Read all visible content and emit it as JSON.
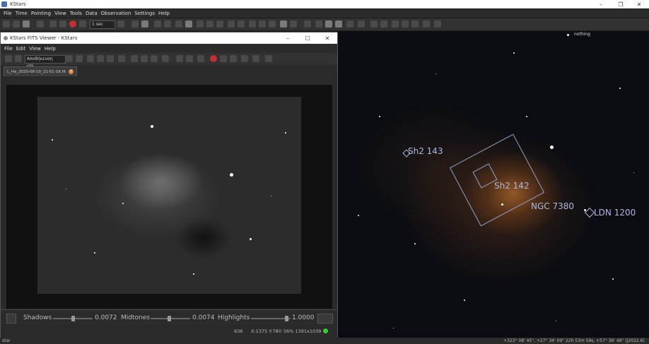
{
  "main_window": {
    "title": "KStars",
    "menu": [
      "File",
      "Time",
      "Pointing",
      "View",
      "Tools",
      "Data",
      "Observation",
      "Settings",
      "Help"
    ],
    "timestep": "1 sec",
    "status_left": "star",
    "status_right": "+323° 08' 45\", +27° 34' 09\" 22h 53m 59s, +57° 36' 48\" (J2022.6)"
  },
  "sky_map": {
    "labels": {
      "nothing": "nothing",
      "sh2_143": "Sh2 143",
      "sh2_142": "Sh2 142",
      "ngc_7380": "NGC 7380",
      "ldn_1200": "LDN 1200"
    }
  },
  "fits_viewer": {
    "title": "KStars FITS Viewer - KStars",
    "menu": [
      "File",
      "Edit",
      "View",
      "Help"
    ],
    "filter_dropdown": "Αποθήκευση ισχ...",
    "tab_label": "L_Ha_2020-08-19_21-51-18.fit",
    "stretch": {
      "shadows_label": "Shadows",
      "shadows_value": "0.0072",
      "midtones_label": "Midtones",
      "midtones_value": "0.0074",
      "highlights_label": "Highlights",
      "highlights_value": "1.0000"
    },
    "status": {
      "value": "636",
      "coords": "X:1375 Y:780",
      "zoom_size": "56% 1391x1039"
    }
  },
  "colors": {
    "sky_label": "#aeb6e0",
    "fov": "#8fa3c8",
    "status_led": "#33cc33"
  }
}
